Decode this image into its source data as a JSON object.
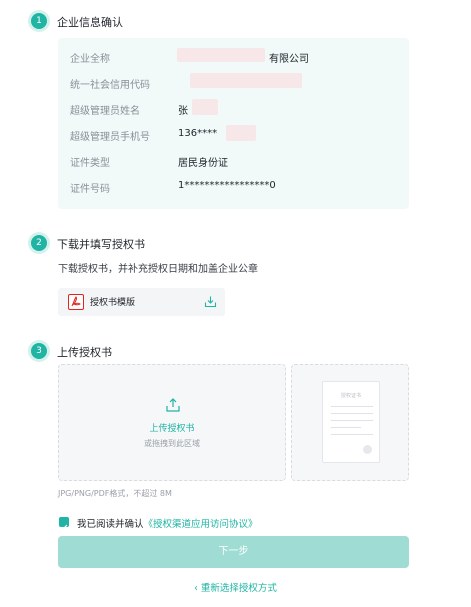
{
  "step1": {
    "number": "1",
    "title": "企业信息确认",
    "rows": [
      {
        "label": "企业全称",
        "value": "有限公司"
      },
      {
        "label": "统一社会信用代码",
        "value": ""
      },
      {
        "label": "超级管理员姓名",
        "value": "张"
      },
      {
        "label": "超级管理员手机号",
        "value": "136****"
      },
      {
        "label": "证件类型",
        "value": "居民身份证"
      },
      {
        "label": "证件号码",
        "value": "1*****************0"
      }
    ]
  },
  "step2": {
    "number": "2",
    "title": "下载并填写授权书",
    "description": "下载授权书，并补充授权日期和加盖企业公章",
    "template_name": "授权书模版"
  },
  "step3": {
    "number": "3",
    "title": "上传授权书",
    "upload_label": "上传授权书",
    "upload_hint": "或拖拽到此区域",
    "sample_title": "授权证书",
    "format_note": "JPG/PNG/PDF格式，不超过 8M"
  },
  "agreement": {
    "checked": true,
    "prefix": "我已阅读并确认",
    "link": "《授权渠道应用访问协议》"
  },
  "next_button": "下一步",
  "back_link": "‹ 重新选择授权方式",
  "colors": {
    "accent": "#1fb4a3",
    "accent_light": "#9fdcd3",
    "card_bg": "#f1faf8"
  }
}
